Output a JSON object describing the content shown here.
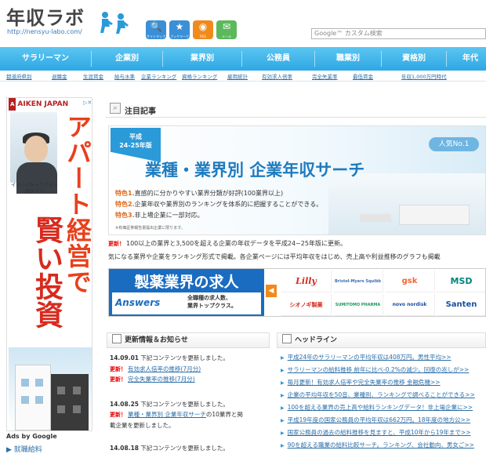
{
  "header": {
    "logo_text": "年収ラボ",
    "logo_url": "http://nensyu-labo.com/",
    "icons": [
      {
        "name": "search-icon",
        "label": "サイトマップ",
        "color": "#3a8fd6",
        "glyph": "🔍"
      },
      {
        "name": "star-icon",
        "label": "ブックマーク",
        "color": "#3a8fd6",
        "glyph": "★"
      },
      {
        "name": "rss-icon",
        "label": "RSS",
        "color": "#f08a1d",
        "glyph": "◉"
      },
      {
        "name": "mail-icon",
        "label": "メール",
        "color": "#5cb85c",
        "glyph": "✉"
      }
    ],
    "search_placeholder": "Google™ カスタム検索"
  },
  "nav": {
    "items": [
      "サラリーマン",
      "企業別",
      "業界別",
      "公務員",
      "職業別",
      "資格別",
      "年代"
    ]
  },
  "subnav": {
    "items": [
      "都道府県別",
      "退職金",
      "生涯賃金",
      "給与水準",
      "企業ランキング",
      "資格ランキング",
      "雇用統計",
      "有効求人倍率",
      "完全失業率",
      "最低賃金",
      "年収1,000万円時代"
    ]
  },
  "ad": {
    "brand": "AIKEN JAPAN",
    "brand_box": "A",
    "caption": "イメージキャラクター\n尾木ママ",
    "vertical_text": "アパート経営で",
    "vertical_text2": "賢い投資",
    "ads_by": "Ads by Google",
    "link": "▶ 就職給料"
  },
  "featured": {
    "title": "注目記事",
    "banner": {
      "badge": "平成\n24-25年版",
      "title": "業種・業界別 企業年収サーチ",
      "ninki": "人気No.1",
      "features": [
        {
          "label": "特色1.",
          "text": "直感的に分かりやすい業界分類が好評(100業界以上)"
        },
        {
          "label": "特色2.",
          "text": "企業年収や業界別のランキングを体系的に把握することができる。"
        },
        {
          "label": "特色3.",
          "text": "非上場企業に一部対応。"
        }
      ],
      "small_note": "※有価証券報告書提出企業に限ります。"
    },
    "update_new": "更新！",
    "update_text": "100以上の業界と3,500を超える企業の年収データを平成24~25年版に更新。",
    "desc_text": "気になる業界や企業をランキング形式で掲載。各企業ページには平均年収をはじめ、売上高や利益推移のグラフも掲載"
  },
  "job_banner": {
    "title": "製薬業界の求人",
    "answers": "Answers",
    "desc": "全職種の求人数、\n業界トップクラス。",
    "arrow": "◀",
    "logos": [
      {
        "text": "Lilly",
        "color": "#d52b1e"
      },
      {
        "text": "Bristol-Myers Squibb",
        "color": "#3c6eb4"
      },
      {
        "text": "gsk",
        "color": "#f36633"
      },
      {
        "text": "MSD",
        "color": "#00857c"
      },
      {
        "text": "シオノギ製薬",
        "color": "#d52b1e"
      },
      {
        "text": "SUMITOMO PHARMA",
        "color": "#1a9a5a"
      },
      {
        "text": "novo nordisk",
        "color": "#1a4f9e"
      },
      {
        "text": "Santen",
        "color": "#1a4f9e"
      }
    ]
  },
  "news": {
    "title": "更新情報＆お知らせ",
    "items": [
      {
        "date": "14.09.01",
        "text": "下記コンテンツを更新しました。"
      },
      {
        "new": "更新！",
        "link": "有効求人倍率の推移(7月分)"
      },
      {
        "new": "更新！",
        "link": "完全失業率の推移(7月分)"
      },
      {
        "date": "14.08.25",
        "text": "下記コンテンツを更新しました。"
      },
      {
        "new": "更新！",
        "link": "業種・業界別 企業年収サーチ",
        "tail": "の10業界と掲"
      },
      {
        "text": "載企業を更新しました。"
      },
      {
        "date": "14.08.18",
        "text": "下記コンテンツを更新しました。"
      }
    ]
  },
  "headline": {
    "title": "ヘッドライン",
    "items": [
      "平成24年のサラリーマンの平均年収は408万円。男性平均>>",
      "サラリーマンの給料推移 前年に比べ-0.2%の減少。回復の兆しが>>",
      "毎月更新！有効求人倍率や完全失業率の推移 金融危機>>",
      "企業の平均年収を50音、業種別、ランキングで調べることができる>>",
      "100を超える業界の売上高や給料ランキングデータ！非上場企業に>>",
      "平成19年度の国家公務員の平均年収は662万円。18年度の地方公>>",
      "国家公務員の過去の給料推移を見ますと、平成10年から19年まで>>",
      "90を超える職業の給料比較サーチ。ランキング、会社動向、男女ご>>"
    ]
  }
}
